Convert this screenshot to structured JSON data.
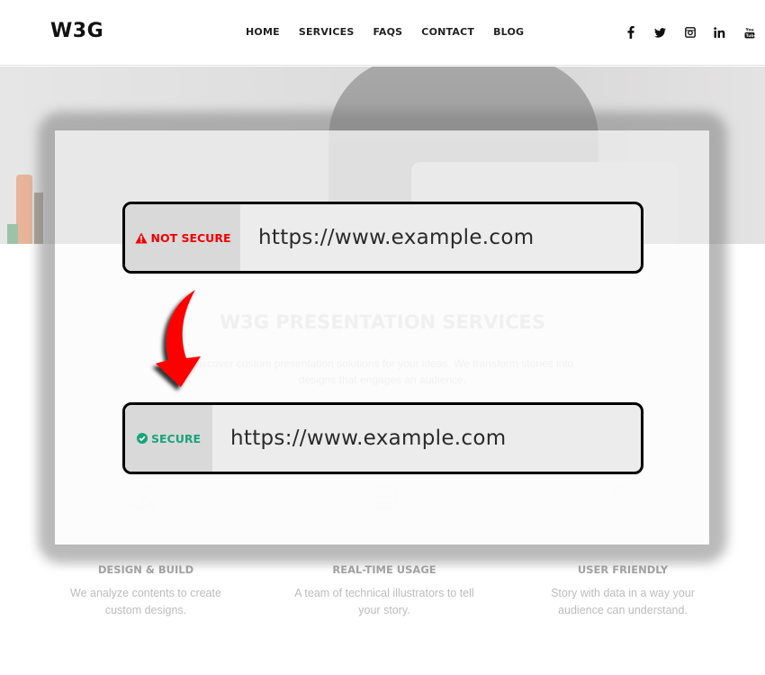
{
  "header": {
    "logo": "W3G",
    "nav": [
      "HOME",
      "SERVICES",
      "FAQS",
      "CONTACT",
      "BLOG"
    ],
    "social_icons": [
      "facebook-icon",
      "twitter-icon",
      "instagram-icon",
      "linkedin-icon",
      "youtube-icon"
    ]
  },
  "services": {
    "title": "W3G PRESENTATION SERVICES",
    "subtitle": "Discover custom presentation solutions for your ideas. We transform stories into designs that engages an audience.",
    "features": [
      {
        "icon": "check-plus-icon",
        "title": "DESIGN & BUILD",
        "description": "We analyze contents to create custom designs."
      },
      {
        "icon": "monitor-pulse-icon",
        "title": "REAL-TIME USAGE",
        "description": "A team of technical illustrators to tell your story."
      },
      {
        "icon": "touch-rotate-icon",
        "title": "USER FRIENDLY",
        "description": "Story with data in a way your audience can understand."
      }
    ]
  },
  "overlay": {
    "insecure_bar": {
      "icon": "warning-triangle-icon",
      "status_label": "NOT SECURE",
      "url": "https://www.example.com",
      "status_color": "#f00000"
    },
    "secure_bar": {
      "icon": "check-circle-icon",
      "status_label": "SECURE",
      "url": "https://www.example.com",
      "status_color": "#1aa37a"
    },
    "arrow": {
      "icon": "curved-arrow-down-icon",
      "color": "#ff0000"
    }
  }
}
